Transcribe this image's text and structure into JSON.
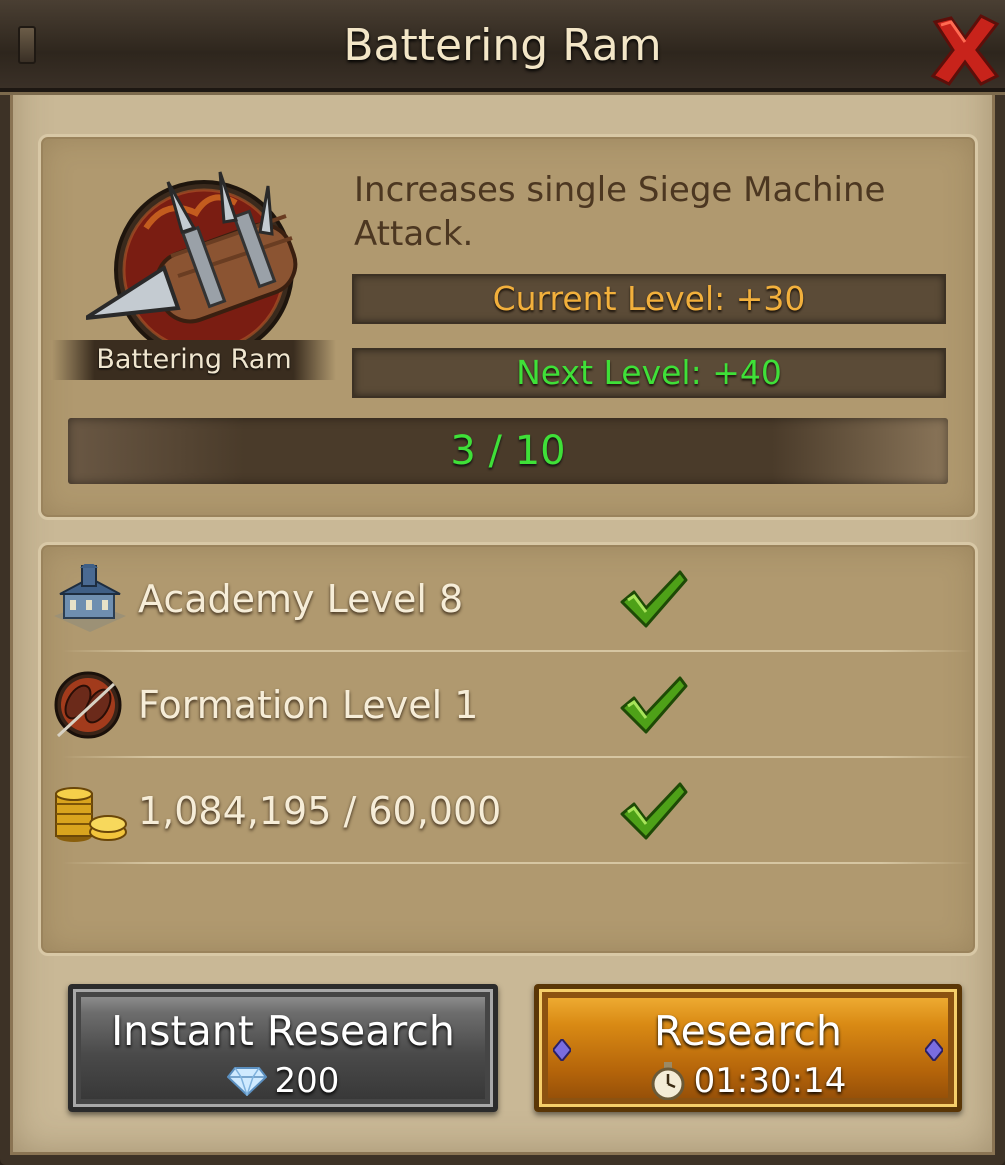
{
  "window": {
    "title": "Battering Ram",
    "close_icon": "close-x-icon"
  },
  "research": {
    "name": "Battering Ram",
    "icon": "battering-ram-icon",
    "description": "Increases single Siege Machine Attack.",
    "current_level": "Current Level: +30",
    "next_level": "Next Level: +40",
    "progress_text": "3 / 10",
    "progress_fraction": 0.3,
    "colors": {
      "current_level": "#f2b03c",
      "next_level": "#3fe038"
    }
  },
  "requirements": [
    {
      "icon": "academy-building-icon",
      "label": "Academy Level 8",
      "met": true,
      "status_icon": "checkmark-icon"
    },
    {
      "icon": "formation-icon",
      "label": "Formation Level 1",
      "met": true,
      "status_icon": "checkmark-icon"
    },
    {
      "icon": "gold-coins-icon",
      "label": "1,084,195 / 60,000",
      "met": true,
      "status_icon": "checkmark-icon"
    }
  ],
  "buttons": {
    "instant": {
      "label": "Instant Research",
      "cost": "200",
      "cost_icon": "diamond-icon"
    },
    "research": {
      "label": "Research",
      "time": "01:30:14",
      "time_icon": "stopwatch-icon"
    }
  }
}
